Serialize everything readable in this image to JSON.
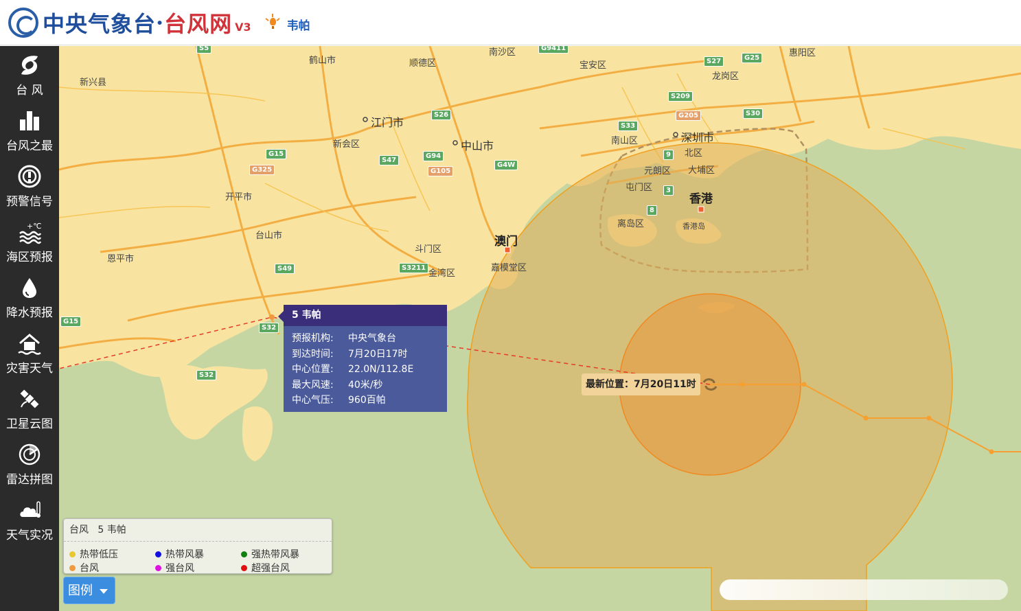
{
  "header": {
    "brand_part1": "中央气象台",
    "brand_dot": "·",
    "brand_part2": "台风网",
    "version": "V3",
    "storm_link": "韦帕"
  },
  "sidebar": {
    "items": [
      {
        "label": "台 风",
        "icon": "typhoon-icon"
      },
      {
        "label": "台风之最",
        "icon": "bar-chart-icon"
      },
      {
        "label": "预警信号",
        "icon": "warning-signal-icon"
      },
      {
        "label": "海区预报",
        "icon": "sea-forecast-icon"
      },
      {
        "label": "降水预报",
        "icon": "raindrop-icon"
      },
      {
        "label": "灾害天气",
        "icon": "disaster-house-icon"
      },
      {
        "label": "卫星云图",
        "icon": "satellite-icon"
      },
      {
        "label": "雷达拼图",
        "icon": "radar-icon"
      },
      {
        "label": "天气实况",
        "icon": "weather-cloud-icon"
      }
    ],
    "sea_icon_text": "+℃"
  },
  "map": {
    "places": {
      "xinxing": "新兴县",
      "heshan": "鹤山市",
      "shunde": "顺德区",
      "nansha": "南沙区",
      "baoan": "宝安区",
      "huiyang": "惠阳区",
      "longgang": "龙岗区",
      "jiangmen": "江门市",
      "xinhui": "新会区",
      "zhongshan": "中山市",
      "nanshan": "南山区",
      "shenzhen": "深圳市",
      "beiqu": "北区",
      "yuanlang": "元朗区",
      "dapu": "大埔区",
      "tunmen": "屯门区",
      "hongkong": "香港",
      "lidao": "离岛区",
      "hkisland": "香港岛",
      "kaiping": "开平市",
      "taishan": "台山市",
      "macau": "澳门",
      "doumen": "斗门区",
      "jinwan": "金湾区",
      "jiamotang": "嘉模堂区",
      "enping": "恩平市"
    },
    "shields": {
      "s5": "S5",
      "g9411": "G9411",
      "s27": "S27",
      "g25": "G25",
      "s209": "S209",
      "g205": "G205",
      "s33": "S33",
      "s30": "S30",
      "s26": "S26",
      "g15a": "G15",
      "g325": "G325",
      "s47": "S47",
      "g94": "G94",
      "g4w": "G4W",
      "g105": "G105",
      "r9": "9",
      "r3": "3",
      "r8": "8",
      "s49": "S49",
      "s3211": "S3211",
      "g15b": "G15",
      "s32a": "S32",
      "s32b": "S32"
    }
  },
  "popup": {
    "title": "5 韦帕",
    "rows": [
      {
        "k": "预报机构:",
        "v": "中央气象台"
      },
      {
        "k": "到达时间:",
        "v": "7月20日17时"
      },
      {
        "k": "中心位置:",
        "v": "22.0N/112.8E"
      },
      {
        "k": "最大风速:",
        "v": "40米/秒"
      },
      {
        "k": "中心气压:",
        "v": "960百帕"
      }
    ]
  },
  "latest": {
    "label": "最新位置：7月20日11时"
  },
  "legend": {
    "header_type": "台风",
    "header_name": "5 韦帕",
    "items": [
      {
        "label": "热带低压",
        "color": "#e8c830"
      },
      {
        "label": "热带风暴",
        "color": "#1010e0"
      },
      {
        "label": "强热带风暴",
        "color": "#108010"
      },
      {
        "label": "台风",
        "color": "#f09a40"
      },
      {
        "label": "强台风",
        "color": "#e010e0"
      },
      {
        "label": "超强台风",
        "color": "#e01010"
      }
    ],
    "button_label": "图例"
  },
  "colors": {
    "sidebar_bg": "#2b2b2b",
    "sea": "#c6d6a3",
    "land": "#f8e4a0",
    "wind_circle_7": "#e0ae5a",
    "wind_circle_10": "#e89a40",
    "track": "#f5a030"
  }
}
